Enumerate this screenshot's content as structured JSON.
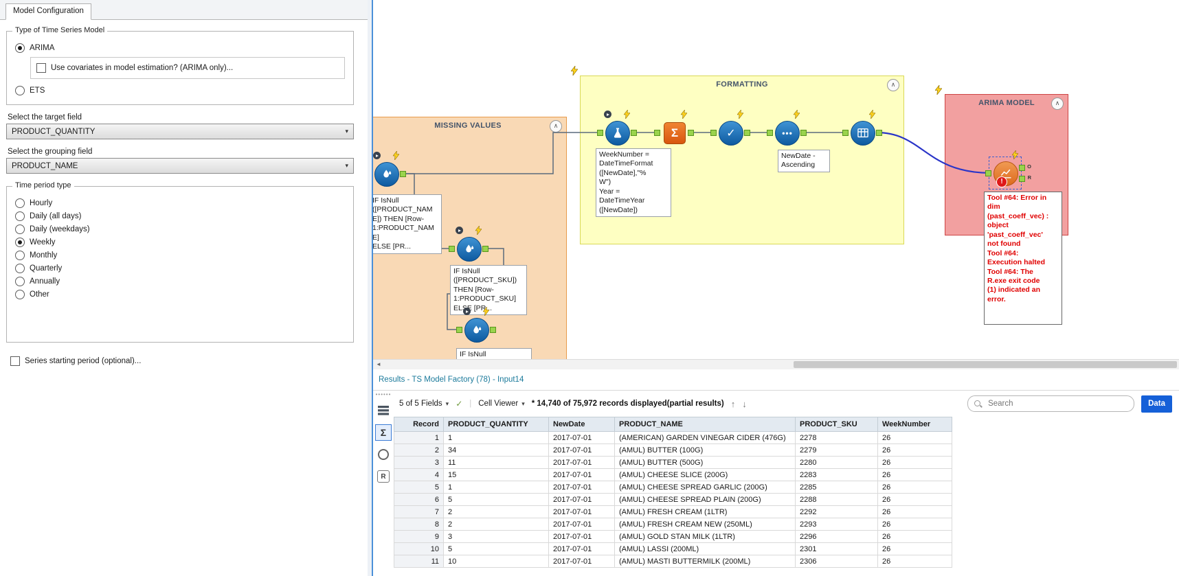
{
  "config_panel": {
    "tab": "Model Configuration",
    "model_type_group": {
      "label": "Type of Time Series Model",
      "options": [
        {
          "label": "ARIMA",
          "selected": true
        },
        {
          "label": "ETS",
          "selected": false
        }
      ],
      "covariates_checkbox": {
        "label": "Use covariates in model estimation? (ARIMA only)...",
        "checked": false
      }
    },
    "target_field": {
      "label": "Select the target field",
      "value": "PRODUCT_QUANTITY"
    },
    "grouping_field": {
      "label": "Select the grouping field",
      "value": "PRODUCT_NAME"
    },
    "time_period_group": {
      "label": "Time period type",
      "options": [
        {
          "label": "Hourly",
          "selected": false
        },
        {
          "label": "Daily (all days)",
          "selected": false
        },
        {
          "label": "Daily (weekdays)",
          "selected": false
        },
        {
          "label": "Weekly",
          "selected": true
        },
        {
          "label": "Monthly",
          "selected": false
        },
        {
          "label": "Quarterly",
          "selected": false
        },
        {
          "label": "Annually",
          "selected": false
        },
        {
          "label": "Other",
          "selected": false
        }
      ]
    },
    "series_start_checkbox": {
      "label": "Series starting period (optional)...",
      "checked": false
    }
  },
  "canvas": {
    "containers": {
      "missing_values": {
        "title": "MISSING VALUES"
      },
      "formatting": {
        "title": "FORMATTING"
      },
      "arima_model": {
        "title": "ARIMA MODEL"
      }
    },
    "annotations": {
      "impute_name": "IF IsNull\n([PRODUCT_NAM\nE]) THEN [Row-\n1:PRODUCT_NAM\nE]\nELSE [PR...",
      "impute_sku": "IF IsNull\n([PRODUCT_SKU])\nTHEN [Row-\n1:PRODUCT_SKU]\nELSE [PR...",
      "impute_third": "IF IsNull",
      "formula": "WeekNumber =\nDateTimeFormat\n([NewDate],\"%\nW\")\nYear =\nDateTimeYear\n([NewDate])",
      "sort": "NewDate -\nAscending",
      "error": "Tool #64: Error in\ndim\n(past_coeff_vec) :\nobject\n'past_coeff_vec'\nnot found\nTool #64:\nExecution halted\nTool #64: The\nR.exe exit code\n(1) indicated an\nerror."
    },
    "anchor_labels": {
      "o": "O",
      "r": "R"
    }
  },
  "results": {
    "title": "Results - TS Model Factory (78) - Input14",
    "toolbar": {
      "fields_selector": "5 of 5 Fields",
      "cell_viewer": "Cell Viewer",
      "record_count": "* 14,740 of 75,972 records displayed(partial results)",
      "search_placeholder": "Search",
      "data_button": "Data"
    },
    "table": {
      "columns": [
        "Record",
        "PRODUCT_QUANTITY",
        "NewDate",
        "PRODUCT_NAME",
        "PRODUCT_SKU",
        "WeekNumber"
      ],
      "rows": [
        [
          "1",
          "1",
          "2017-07-01",
          "(AMERICAN) GARDEN VINEGAR CIDER (476G)",
          "2278",
          "26"
        ],
        [
          "2",
          "34",
          "2017-07-01",
          "(AMUL) BUTTER (100G)",
          "2279",
          "26"
        ],
        [
          "3",
          "11",
          "2017-07-01",
          "(AMUL) BUTTER (500G)",
          "2280",
          "26"
        ],
        [
          "4",
          "15",
          "2017-07-01",
          "(AMUL) CHEESE SLICE (200G)",
          "2283",
          "26"
        ],
        [
          "5",
          "1",
          "2017-07-01",
          "(AMUL) CHEESE SPREAD GARLIC (200G)",
          "2285",
          "26"
        ],
        [
          "6",
          "5",
          "2017-07-01",
          "(AMUL) CHEESE SPREAD PLAIN (200G)",
          "2288",
          "26"
        ],
        [
          "7",
          "2",
          "2017-07-01",
          "(AMUL) FRESH CREAM (1LTR)",
          "2292",
          "26"
        ],
        [
          "8",
          "2",
          "2017-07-01",
          "(AMUL) FRESH CREAM NEW (250ML)",
          "2293",
          "26"
        ],
        [
          "9",
          "3",
          "2017-07-01",
          "(AMUL) GOLD STAN MILK (1LTR)",
          "2296",
          "26"
        ],
        [
          "10",
          "5",
          "2017-07-01",
          "(AMUL) LASSI (200ML)",
          "2301",
          "26"
        ],
        [
          "11",
          "10",
          "2017-07-01",
          "(AMUL) MASTI BUTTERMILK (200ML)",
          "2306",
          "26"
        ]
      ]
    }
  },
  "icons": {
    "collapse_glyph": "∧",
    "dropdown_arrow": "▾",
    "summarize_glyph": "Σ",
    "check_glyph": "✓",
    "dots_glyph": "•••",
    "error_glyph": "!",
    "up_arrow": "↑",
    "down_arrow": "↓",
    "scroll_left_arrow": "◄",
    "fields_check_glyph": "✓",
    "strip_sigma": "Σ",
    "strip_r": "R",
    "gripper_dots": "••••••"
  },
  "colors": {
    "container_missing_values": "#f9d9b5",
    "container_formatting": "#feffc2",
    "container_arima": "#f2a0a0",
    "error_text": "#e00000",
    "selected_wire": "#2a35c8",
    "anchor_green": "#9ad34d",
    "results_link": "#1b7a9b",
    "data_button": "#1560d8"
  }
}
